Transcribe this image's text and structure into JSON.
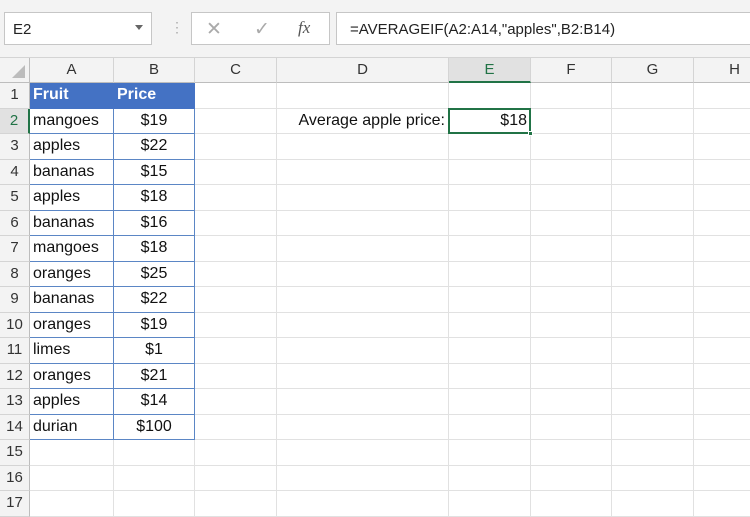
{
  "name_box": "E2",
  "formula_bar": {
    "cancel_icon": "✕",
    "enter_icon": "✓",
    "fx_label": "fx",
    "formula": "=AVERAGEIF(A2:A14,\"apples\",B2:B14)"
  },
  "columns": [
    "A",
    "B",
    "C",
    "D",
    "E",
    "F",
    "G",
    "H"
  ],
  "rows": [
    "1",
    "2",
    "3",
    "4",
    "5",
    "6",
    "7",
    "8",
    "9",
    "10",
    "11",
    "12",
    "13",
    "14",
    "15",
    "16",
    "17"
  ],
  "table": {
    "headers": [
      "Fruit",
      "Price"
    ],
    "data": [
      [
        "mangoes",
        "$19"
      ],
      [
        "apples",
        "$22"
      ],
      [
        "bananas",
        "$15"
      ],
      [
        "apples",
        "$18"
      ],
      [
        "bananas",
        "$16"
      ],
      [
        "mangoes",
        "$18"
      ],
      [
        "oranges",
        "$25"
      ],
      [
        "bananas",
        "$22"
      ],
      [
        "oranges",
        "$19"
      ],
      [
        "limes",
        "$1"
      ],
      [
        "oranges",
        "$21"
      ],
      [
        "apples",
        "$14"
      ],
      [
        "durian",
        "$100"
      ]
    ]
  },
  "label_d2": "Average apple price:",
  "value_e2": "$18",
  "colors": {
    "accent": "#217346",
    "table_header": "#4472c4"
  }
}
